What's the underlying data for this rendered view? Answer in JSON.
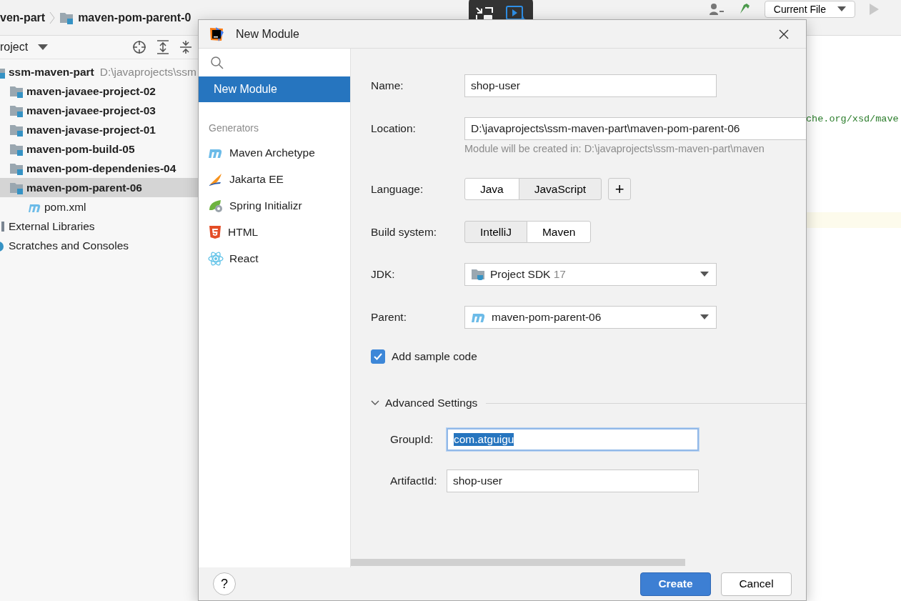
{
  "ide": {
    "breadcrumbs": [
      "ven-part",
      "maven-pom-parent-0"
    ],
    "run_config": "Current File",
    "project_panel": {
      "title": "roject",
      "tree": [
        {
          "label": "ssm-maven-part",
          "path": "D:\\javaprojects\\ssm",
          "kind": "root",
          "selected": false,
          "children": [
            {
              "label": "maven-javaee-project-02",
              "kind": "module",
              "selected": false
            },
            {
              "label": "maven-javaee-project-03",
              "kind": "module",
              "selected": false
            },
            {
              "label": "maven-javase-project-01",
              "kind": "module",
              "selected": false
            },
            {
              "label": "maven-pom-build-05",
              "kind": "module",
              "selected": false
            },
            {
              "label": "maven-pom-dependenies-04",
              "kind": "module",
              "selected": false
            },
            {
              "label": "maven-pom-parent-06",
              "kind": "module",
              "selected": true,
              "children": [
                {
                  "label": "pom.xml",
                  "kind": "file",
                  "selected": false
                }
              ]
            }
          ]
        },
        {
          "label": "External Libraries",
          "kind": "library",
          "selected": false
        },
        {
          "label": "Scratches and Consoles",
          "kind": "scratch",
          "selected": false
        }
      ]
    },
    "editor": {
      "lines": [
        "che.org/xsd/mave"
      ]
    }
  },
  "dialog": {
    "title": "New Module",
    "sidebar": {
      "items": [
        {
          "label": "New Module",
          "selected": true
        }
      ],
      "section": "Generators",
      "generators": [
        {
          "label": "Maven Archetype",
          "kind": "maven",
          "selected": false
        },
        {
          "label": "Jakarta EE",
          "kind": "jakarta",
          "selected": false
        },
        {
          "label": "Spring Initializr",
          "kind": "spring",
          "selected": false
        },
        {
          "label": "HTML",
          "kind": "html",
          "selected": false
        },
        {
          "label": "React",
          "kind": "react",
          "selected": false
        }
      ]
    },
    "form": {
      "name": {
        "label": "Name:",
        "value": "shop-user"
      },
      "location": {
        "label": "Location:",
        "value": "D:\\javaprojects\\ssm-maven-part\\maven-pom-parent-06",
        "hint": "Module will be created in: D:\\javaprojects\\ssm-maven-part\\maven"
      },
      "language": {
        "label": "Language:",
        "options": [
          {
            "label": "Java",
            "selected": true
          },
          {
            "label": "JavaScript",
            "selected": false
          }
        ],
        "add": "+"
      },
      "build_system": {
        "label": "Build system:",
        "options": [
          {
            "label": "IntelliJ",
            "selected": false
          },
          {
            "label": "Maven",
            "selected": true
          }
        ]
      },
      "jdk": {
        "label": "JDK:",
        "value": "Project SDK",
        "version": "17"
      },
      "parent": {
        "label": "Parent:",
        "value": "maven-pom-parent-06"
      },
      "sample_code": {
        "label": "Add sample code",
        "checked": true
      },
      "advanced": {
        "label": "Advanced Settings",
        "expanded": true,
        "fields": [
          {
            "label": "GroupId:",
            "value": "com.atguigu",
            "focused": true,
            "text_selected": true
          },
          {
            "label": "ArtifactId:",
            "value": "shop-user",
            "focused": false,
            "text_selected": false
          }
        ]
      }
    },
    "help": "?",
    "buttons": [
      {
        "label": "Create",
        "primary": true
      },
      {
        "label": "Cancel",
        "primary": false
      }
    ]
  }
}
